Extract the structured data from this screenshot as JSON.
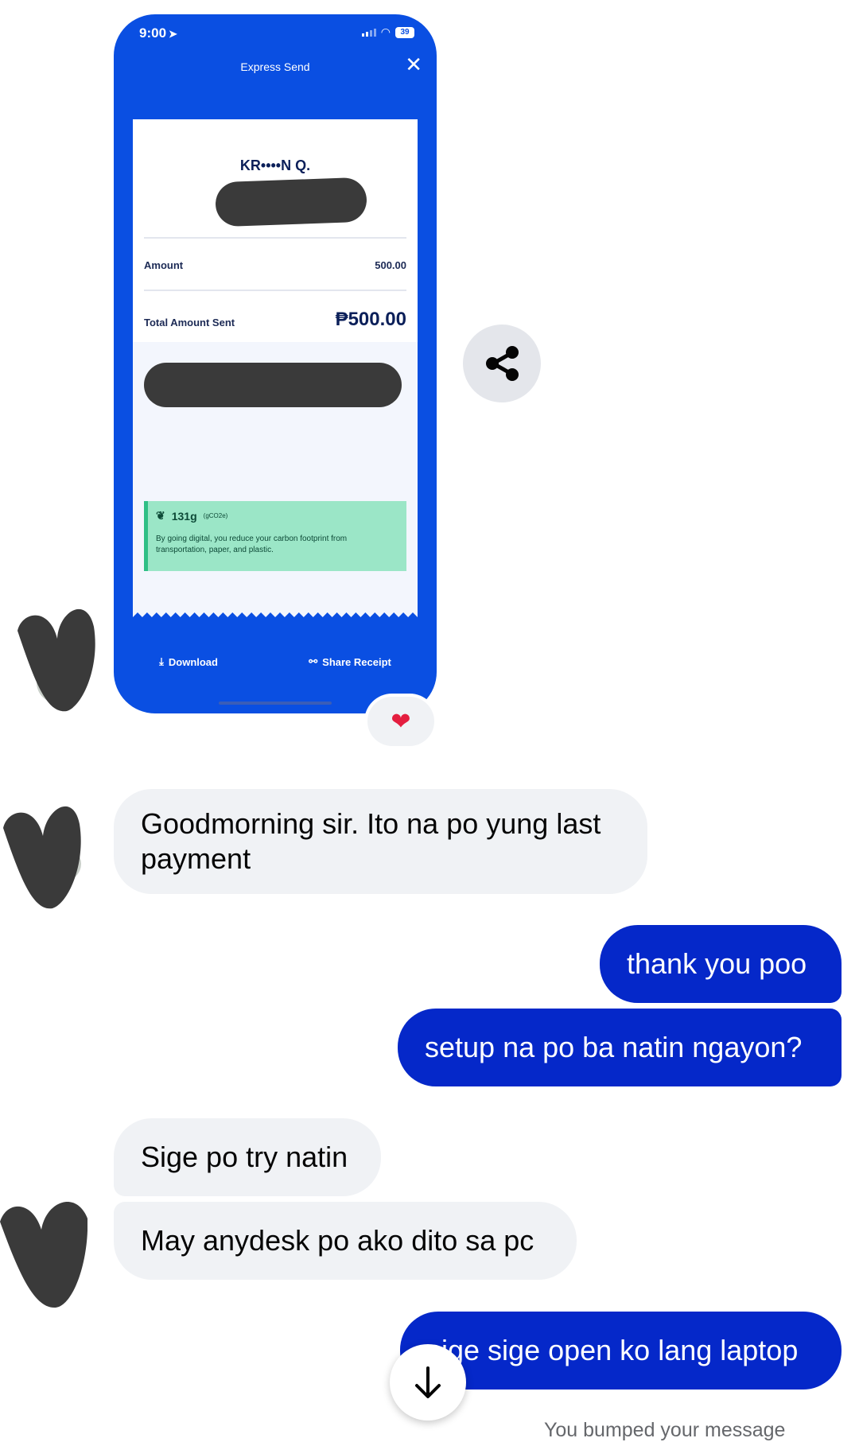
{
  "receipt": {
    "status_time": "9:00",
    "battery": "39",
    "title": "Express Send",
    "recipient": "KR••••N Q.",
    "amount_label": "Amount",
    "amount_value": "500.00",
    "total_label": "Total Amount Sent",
    "total_value": "₱500.00",
    "carbon_value": "131g",
    "carbon_unit": "(gCO2e)",
    "carbon_text": "By going digital, you reduce your carbon footprint from transportation, paper, and plastic.",
    "download_label": "Download",
    "share_receipt_label": "Share Receipt"
  },
  "reaction": "❤",
  "messages": [
    {
      "id": "m1",
      "direction": "incoming",
      "text": "Goodmorning sir. Ito na po yung last payment"
    },
    {
      "id": "m2",
      "direction": "outgoing",
      "text": "thank you poo"
    },
    {
      "id": "m3",
      "direction": "outgoing",
      "text": "setup na po ba natin ngayon?"
    },
    {
      "id": "m4",
      "direction": "incoming",
      "text": "Sige po try natin"
    },
    {
      "id": "m5",
      "direction": "incoming",
      "text": "May anydesk po ako dito sa pc"
    },
    {
      "id": "m6",
      "direction": "outgoing",
      "text": "sige sige open ko lang laptop"
    }
  ],
  "footer": {
    "bumped_text": "You bumped your message"
  },
  "icons": {
    "share": "share-icon",
    "scroll_down": "arrow-down-icon",
    "check": "check-circle-icon",
    "close": "close-icon"
  },
  "colors": {
    "outgoing_bubble": "#0528c9",
    "incoming_bubble": "#f0f2f5",
    "receipt_blue": "#0a4fe2"
  }
}
